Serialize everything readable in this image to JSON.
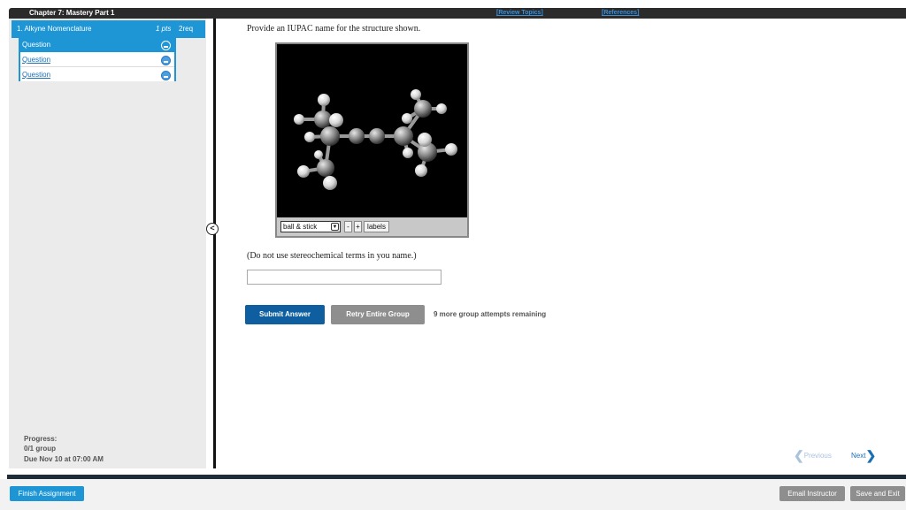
{
  "header": {
    "chapter_title": "Chapter 7: Mastery Part 1",
    "review_topics_link": "[Review Topics]",
    "references_link": "[References]"
  },
  "sidebar": {
    "assignment": {
      "name": "1. Alkyne Nomenclature",
      "points": "1 pts",
      "required": "2req"
    },
    "questions": [
      {
        "label": "Question"
      },
      {
        "label": "Question"
      },
      {
        "label": "Question"
      }
    ],
    "progress_label": "Progress:",
    "progress_value": "0/1 group",
    "due": "Due Nov 10 at 07:00 AM",
    "collapse_icon": "<"
  },
  "question": {
    "prompt": "Provide an IUPAC name for the structure shown.",
    "note": "(Do not use stereochemical terms in you name.)",
    "answer_value": ""
  },
  "viewer": {
    "mode_selected": "ball & stick",
    "zoom_out": "-",
    "zoom_in": "+",
    "labels_button": "labels"
  },
  "actions": {
    "submit": "Submit Answer",
    "retry": "Retry Entire Group",
    "attempts_remaining": "9 more group attempts remaining",
    "previous": "Previous",
    "next": "Next"
  },
  "footer": {
    "finish": "Finish Assignment",
    "email": "Email Instructor",
    "save_exit": "Save and Exit"
  },
  "colors": {
    "accent": "#1e95d4",
    "submit": "#0f5fa0",
    "disabled_button": "#8e8e8e"
  }
}
